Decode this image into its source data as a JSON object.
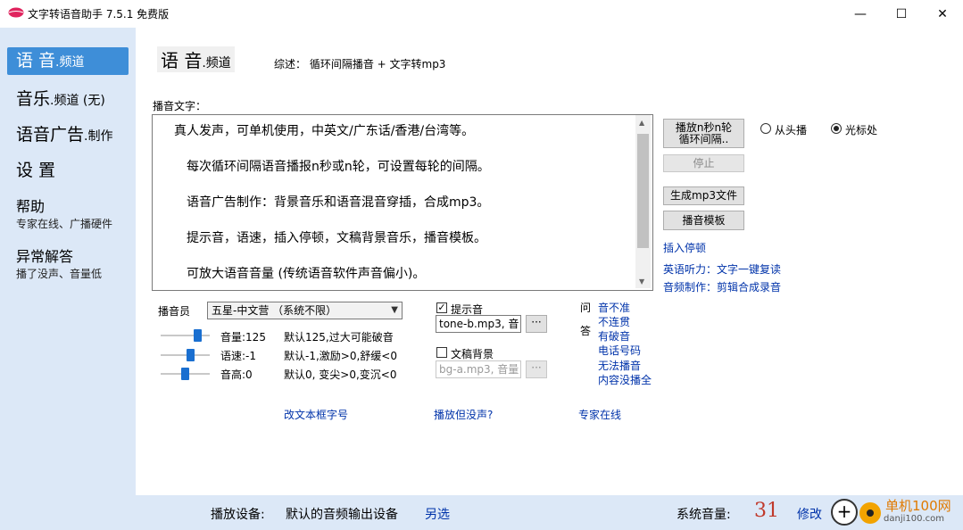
{
  "window": {
    "title": "文字转语音助手 7.5.1 免费版",
    "minimize_glyph": "—",
    "maximize_glyph": "☐",
    "close_glyph": "✕"
  },
  "sidebar": {
    "items": [
      {
        "main": "语 音",
        "suffix": ".频道"
      },
      {
        "main": "音乐",
        "suffix": ".频道 (无)"
      },
      {
        "main": "语音广告",
        "suffix": ".制作"
      },
      {
        "main": "设 置"
      },
      {
        "main": "帮助",
        "sub": "专家在线、广播硬件"
      },
      {
        "main": "异常解答",
        "sub": "播了没声、音量低"
      }
    ]
  },
  "main": {
    "title": "语 音",
    "title_suffix": ".频道",
    "summary": "综述： 循环间隔播音 + 文字转mp3",
    "text_label": "播音文字：",
    "paragraphs": [
      "真人发声，可单机使用，中英文/广东话/香港/台湾等。",
      "每次循环间隔语音播报n秒或n轮，可设置每轮的间隔。",
      "语音广告制作：背景音乐和语音混音穿插，合成mp3。",
      "提示音，语速，插入停顿，文稿背景音乐，播音模板。",
      "可放大语音音量 (传统语音软件声音偏小)。"
    ]
  },
  "controls": {
    "play_btn_line1": "播放n秒n轮",
    "play_btn_line2": "循环间隔..",
    "stop_btn": "停止",
    "gen_mp3_btn": "生成mp3文件",
    "template_btn": "播音模板",
    "insert_pause": "插入停顿",
    "english_link": "英语听力：文字一键复读",
    "audio_link": "音频制作：剪辑合成录音",
    "radio_from_start": "从头播",
    "radio_cursor": "光标处"
  },
  "voice": {
    "announcer_label": "播音员",
    "announcer_value": "五星-中文营 （系统不限）",
    "volume_label": "音量:125",
    "volume_hint": "默认125,过大可能破音",
    "speed_label": "语速:-1",
    "speed_hint": "默认-1,激励>0,舒缓<0",
    "pitch_label": "音高:0",
    "pitch_hint": "默认0, 变尖>0,变沉<0",
    "volume_level": 0.8,
    "speed_level": 0.62,
    "pitch_level": 0.5
  },
  "sound": {
    "tone_label": "提示音",
    "tone_checked": "✓",
    "tone_value": "tone-b.mp3, 音",
    "bg_label": "文稿背景",
    "bg_value": "bg-a.mp3, 音量",
    "browse": "···"
  },
  "qa": {
    "q": "问",
    "a": "答",
    "items": [
      "音不准",
      "不连贯",
      "有破音",
      "电话号码",
      "无法播音",
      "内容没播全"
    ]
  },
  "bottom_links": {
    "font_size": "改文本框字号",
    "no_sound": "播放但没声?",
    "expert": "专家在线"
  },
  "status": {
    "device_label": "播放设备:",
    "device_value": "默认的音频输出设备",
    "device_change": "另选",
    "sys_volume_label": "系统音量:",
    "sys_volume_value": "31",
    "modify": "修改"
  },
  "watermark": {
    "site_cn": "单机100网",
    "site_url": "danji100.com"
  },
  "colors": {
    "sidebar_bg": "#dce8f7",
    "active_nav": "#3e8ed8",
    "link": "#0033aa",
    "volume_number": "#c0392b"
  }
}
